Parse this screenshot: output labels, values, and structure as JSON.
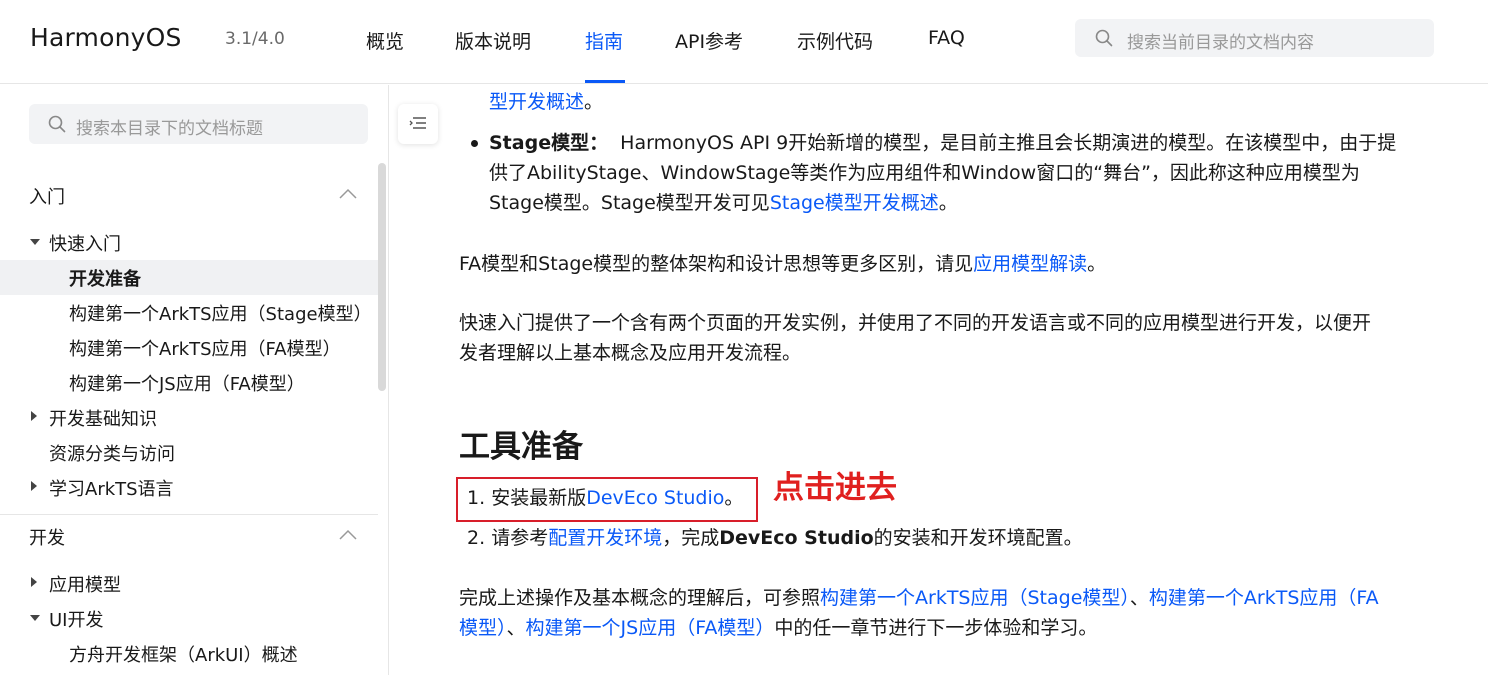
{
  "header": {
    "brand": "HarmonyOS",
    "version": "3.1/4.0",
    "nav": [
      "概览",
      "版本说明",
      "指南",
      "API参考",
      "示例代码",
      "FAQ"
    ],
    "active_nav": "指南",
    "search_placeholder": "搜索当前目录的文档内容"
  },
  "sidebar": {
    "search_placeholder": "搜索本目录下的文档标题",
    "section1": "入门",
    "quick_start": "快速入门",
    "dev_prep": "开发准备",
    "build_arkts_stage": "构建第一个ArkTS应用（Stage模型）",
    "build_arkts_fa": "构建第一个ArkTS应用（FA模型）",
    "build_js_fa": "构建第一个JS应用（FA模型）",
    "dev_basics": "开发基础知识",
    "resources": "资源分类与访问",
    "learn_arkts": "学习ArkTS语言",
    "section2": "开发",
    "app_model": "应用模型",
    "ui_dev": "UI开发",
    "arkui_overview": "方舟开发框架（ArkUI）概述"
  },
  "content": {
    "top_link": "型开发概述",
    "top_tail": "。",
    "stage_label": "Stage模型：",
    "stage_text1": "HarmonyOS API 9开始新增的模型，是目前主推且会长期演进的模型。在该模型中，由于提",
    "stage_text2": "供了AbilityStage、WindowStage等类作为应用组件和Window窗口的“舞台”，因此称这种应用模型为",
    "stage_text3a": "Stage模型。Stage模型开发可见",
    "stage_link": "Stage模型开发概述",
    "stage_text3b": "。",
    "fa_text": "FA模型和Stage模型的整体架构和设计思想等更多区别，请见",
    "fa_link": "应用模型解读",
    "fa_tail": "。",
    "quick_text1": "快速入门提供了一个含有两个页面的开发实例，并使用了不同的开发语言或不同的应用模型进行开发，以便开",
    "quick_text2": "发者理解以上基本概念及应用开发流程。",
    "tools_heading": "工具准备",
    "step1_num": "1.",
    "step1_text": "安装最新版",
    "step1_link": "DevEco Studio",
    "step1_tail": "。",
    "step2_num": "2.",
    "step2_text": "请参考",
    "step2_link": "配置开发环境",
    "step2_mid": "，完成",
    "step2_bold": "DevEco Studio",
    "step2_tail": "的安装和开发环境配置。",
    "final_text1": "完成上述操作及基本概念的理解后，可参照",
    "final_link1": "构建第一个ArkTS应用（Stage模型）",
    "final_sep1": "、",
    "final_link2a": "构建第一个ArkTS应用（FA",
    "final_link2b": "模型）",
    "final_sep2": "、",
    "final_link3": "构建第一个JS应用（FA模型）",
    "final_tail": "中的任一章节进行下一步体验和学习。"
  },
  "annotation": "点击进去",
  "colors": {
    "accent": "#0a59f7",
    "annotation_red": "#e0201f"
  }
}
